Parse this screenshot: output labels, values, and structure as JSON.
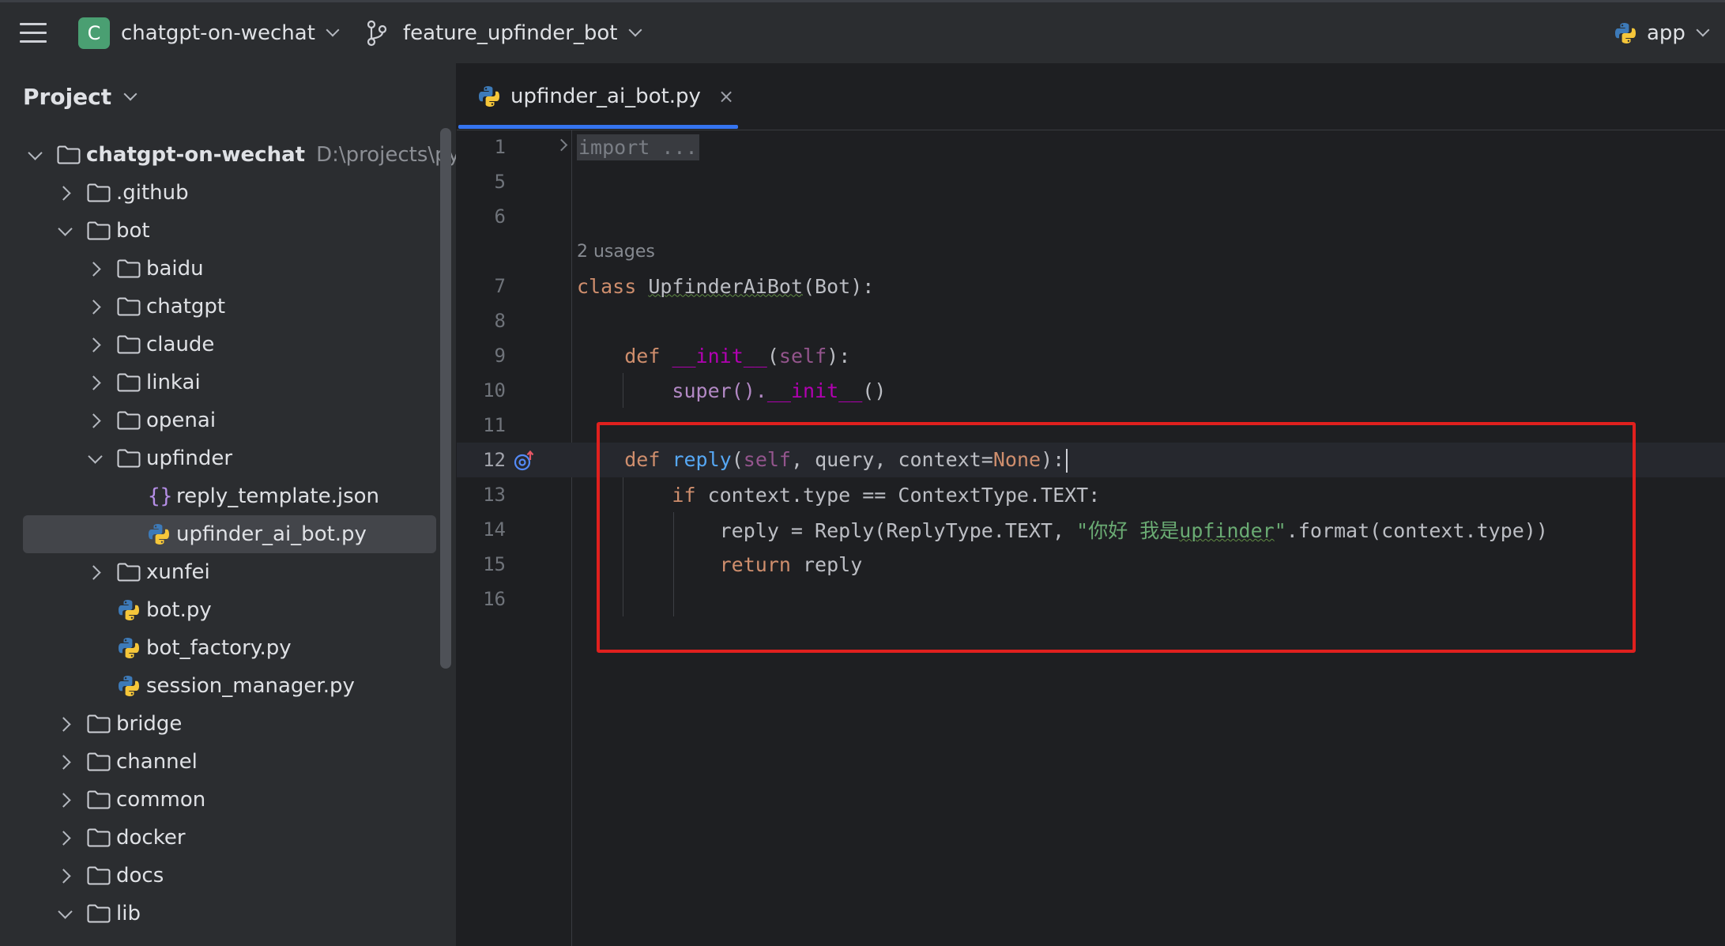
{
  "titlebar": {
    "project_initial": "C",
    "project_name": "chatgpt-on-wechat",
    "branch_name": "feature_upfinder_bot",
    "run_config": "app"
  },
  "sidebar": {
    "title": "Project",
    "root": {
      "label": "chatgpt-on-wechat",
      "path_hint": "D:\\projects\\pyth"
    },
    "items": {
      "github": ".github",
      "bot": "bot",
      "baidu": "baidu",
      "chatgpt": "chatgpt",
      "claude": "claude",
      "linkai": "linkai",
      "openai": "openai",
      "upfinder": "upfinder",
      "reply_template": "reply_template.json",
      "upfinder_ai_bot": "upfinder_ai_bot.py",
      "xunfei": "xunfei",
      "bot_py": "bot.py",
      "bot_factory": "bot_factory.py",
      "session_manager": "session_manager.py",
      "bridge": "bridge",
      "channel": "channel",
      "common": "common",
      "docker": "docker",
      "docs": "docs",
      "lib": "lib"
    }
  },
  "editor": {
    "tab_label": "upfinder_ai_bot.py",
    "tab_close": "×",
    "usages_hint": "2 usages",
    "line_numbers": [
      "1",
      "5",
      "6",
      "7",
      "8",
      "9",
      "10",
      "11",
      "12",
      "13",
      "14",
      "15",
      "16"
    ],
    "code": {
      "import_folded": "import ...",
      "class_kw": "class",
      "class_name": "UpfinderAiBot",
      "class_rest": "(Bot):",
      "def1": "def",
      "init_name": "__init__",
      "init_open": "(",
      "self1": "self",
      "init_close": "):",
      "super_call": "super().",
      "super_init": "__init__",
      "super_parens": "()",
      "def2": "def",
      "reply_name": "reply",
      "reply_open": "(",
      "self2": "self",
      "reply_params": ", query, context=",
      "none_kw": "None",
      "reply_close": "):",
      "if_kw": "if",
      "if_rest": " context.type == ContextType.TEXT:",
      "assign_left": "reply = Reply(ReplyType.TEXT, ",
      "str_open": "\"你好 我是",
      "str_word": "upfinder",
      "str_close": "\"",
      "assign_right": ".format(context.type))",
      "return_kw": "return",
      "return_rest": " reply"
    }
  },
  "colors": {
    "accent": "#3574f0",
    "highlight_box": "#e0201e",
    "keyword": "#cf8e6d",
    "function": "#56a8f5",
    "string": "#6aab73",
    "self": "#94558d",
    "dunder": "#b200b2"
  },
  "icons": {
    "menu": "hamburger-icon",
    "branch": "git-branch-icon",
    "python": "python-file-icon",
    "folder": "folder-icon",
    "json": "json-file-icon",
    "override": "override-method-icon"
  }
}
